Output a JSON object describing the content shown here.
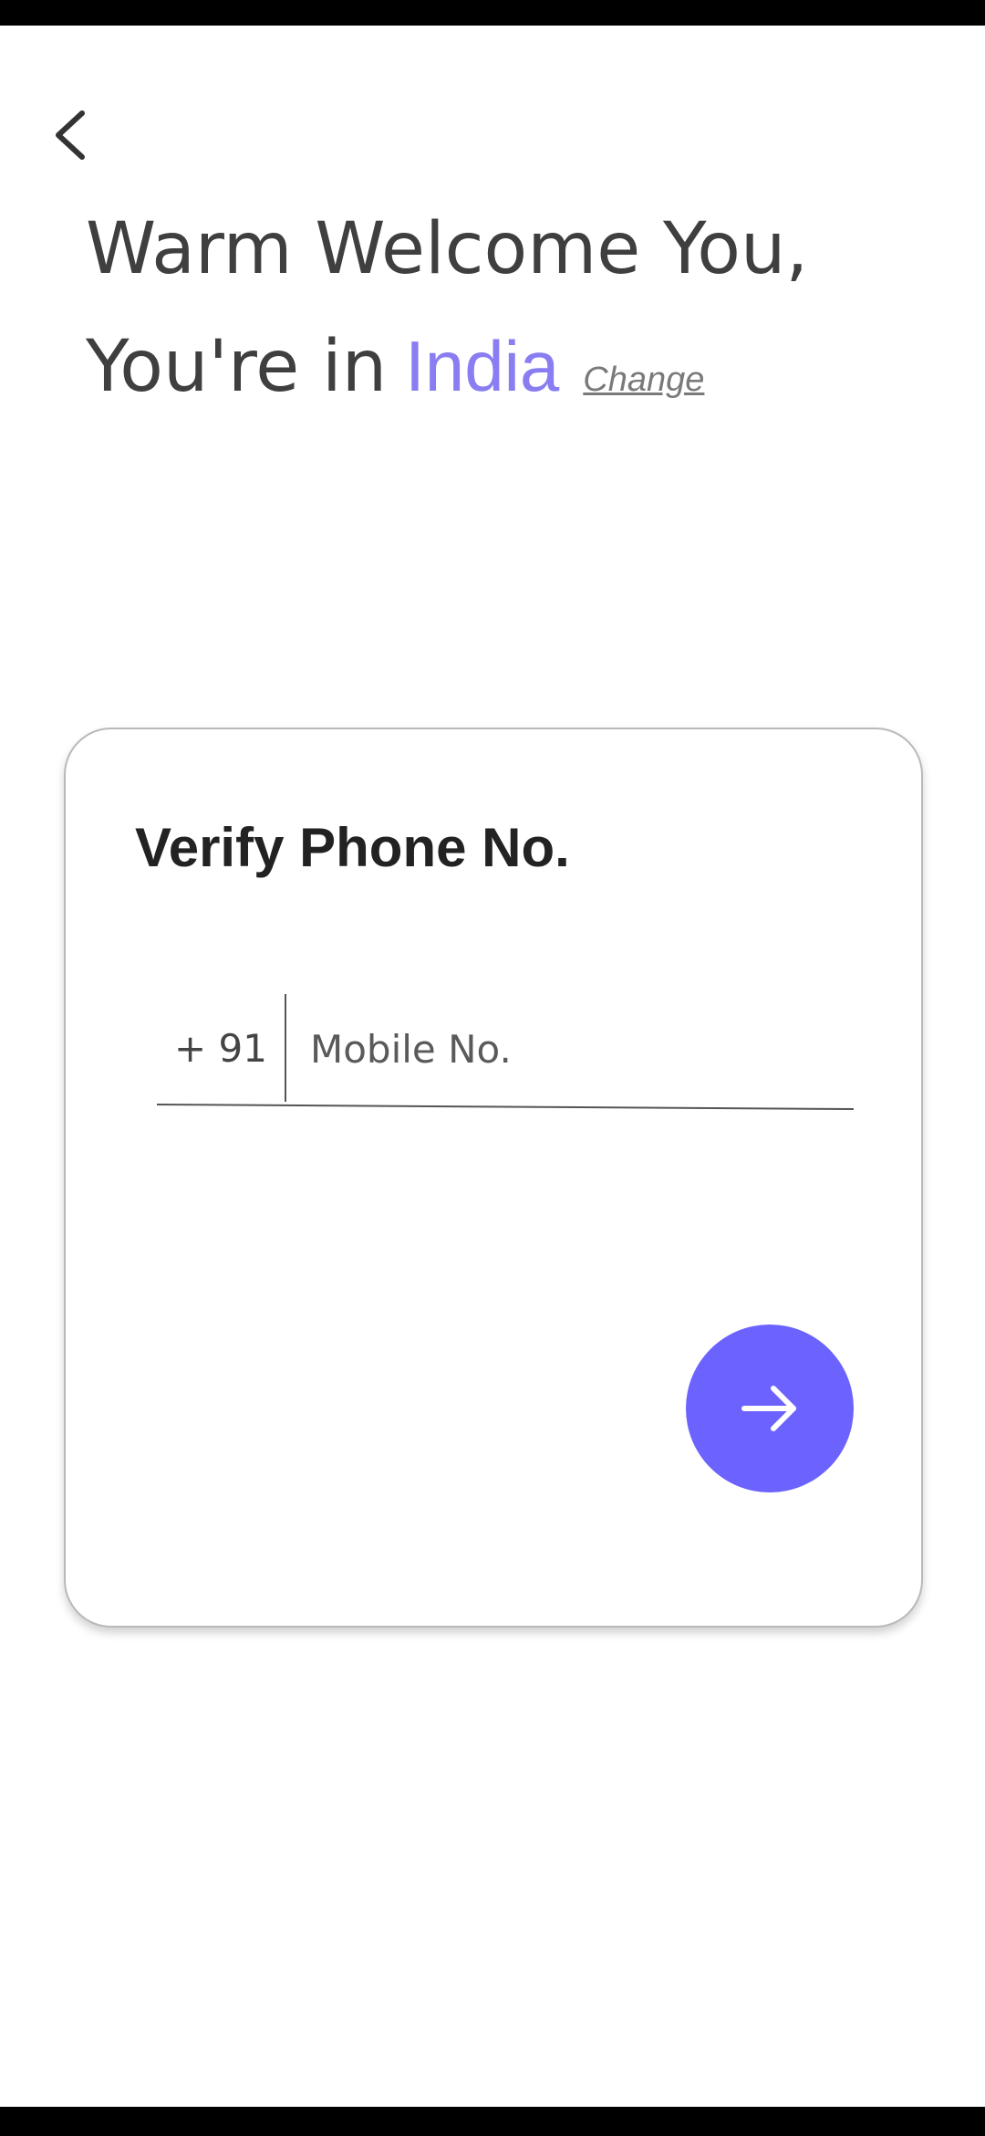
{
  "header": {
    "back_icon": "chevron-left-icon",
    "welcome_line1": "Warm Welcome You,",
    "welcome_prefix": "You're in",
    "country_name": "India",
    "change_label": "Change"
  },
  "verify_card": {
    "title": "Verify Phone No.",
    "country_code": "+ 91",
    "mobile_placeholder": "Mobile No.",
    "mobile_value": "",
    "next_icon": "arrow-right-icon"
  },
  "colors": {
    "accent": "#6c63ff",
    "country_text": "#8a7df2",
    "heading_text": "#3f3f3f"
  }
}
